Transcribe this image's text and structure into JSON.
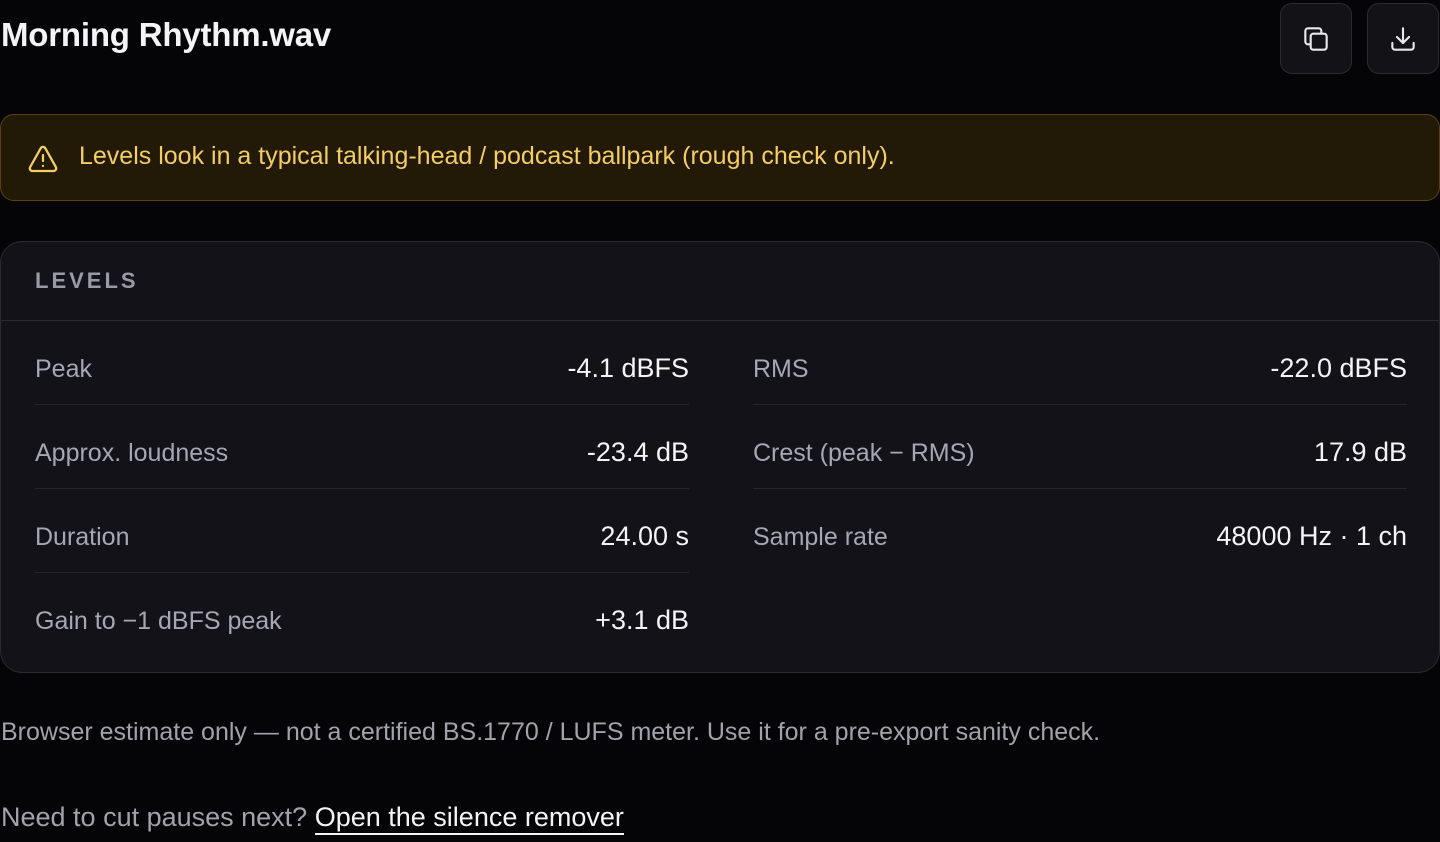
{
  "header": {
    "title": "Morning Rhythm.wav",
    "actions": [
      {
        "icon": "copy-icon"
      },
      {
        "icon": "download-icon"
      }
    ]
  },
  "alert": {
    "icon": "warning-triangle-icon",
    "text": "Levels look in a typical talking-head / podcast ballpark (rough check only).",
    "color": "#f4cd63"
  },
  "levels": {
    "title": "LEVELS",
    "left": [
      {
        "label": "Peak",
        "value": "-4.1 dBFS"
      },
      {
        "label": "Approx. loudness",
        "value": "-23.4 dB"
      },
      {
        "label": "Duration",
        "value": "24.00 s"
      },
      {
        "label": "Gain to −1 dBFS peak",
        "value": "+3.1 dB"
      }
    ],
    "right": [
      {
        "label": "RMS",
        "value": "-22.0 dBFS"
      },
      {
        "label": "Crest (peak − RMS)",
        "value": "17.9 dB"
      },
      {
        "label": "Sample rate",
        "value": "48000 Hz · 1 ch"
      }
    ]
  },
  "footer": {
    "note": "Browser estimate only — not a certified BS.1770 / LUFS meter. Use it for a pre-export sanity check.",
    "next_prefix": "Need to cut pauses next?",
    "next_link": "Open the silence remover"
  }
}
